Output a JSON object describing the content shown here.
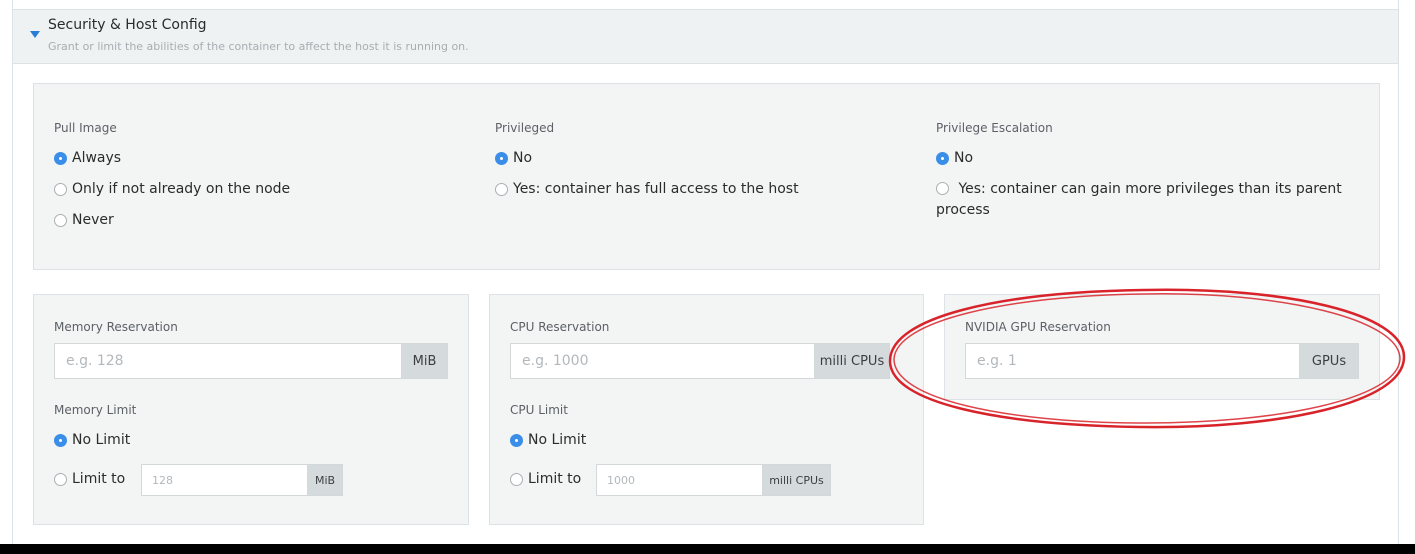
{
  "section": {
    "title": "Security & Host Config",
    "description": "Grant or limit the abilities of the container to affect the host it is running on."
  },
  "pull_image": {
    "label": "Pull Image",
    "options": [
      "Always",
      "Only if not already on the node",
      "Never"
    ],
    "selected": "Always"
  },
  "privileged": {
    "label": "Privileged",
    "options": [
      "No",
      "Yes: container has full access to the host"
    ],
    "selected": "No"
  },
  "privilege_escalation": {
    "label": "Privilege Escalation",
    "options": [
      "No",
      "Yes: container can gain more privileges than its parent process"
    ],
    "selected": "No"
  },
  "memory": {
    "reservation_label": "Memory Reservation",
    "reservation_placeholder": "e.g. 128",
    "reservation_unit": "MiB",
    "limit_label": "Memory Limit",
    "no_limit_label": "No Limit",
    "limit_to_label": "Limit to",
    "limit_placeholder": "128",
    "limit_unit": "MiB"
  },
  "cpu": {
    "reservation_label": "CPU Reservation",
    "reservation_placeholder": "e.g. 1000",
    "reservation_unit": "milli CPUs",
    "limit_label": "CPU Limit",
    "no_limit_label": "No Limit",
    "limit_to_label": "Limit to",
    "limit_placeholder": "1000",
    "limit_unit": "milli CPUs"
  },
  "gpu": {
    "reservation_label": "NVIDIA GPU Reservation",
    "reservation_placeholder": "e.g. 1",
    "reservation_unit": "GPUs"
  },
  "colors": {
    "accent": "#3a8ee8",
    "panel_bg": "#f3f5f5",
    "annotation": "#d8232a"
  },
  "icons": {
    "collapse": "caret-down-icon"
  }
}
